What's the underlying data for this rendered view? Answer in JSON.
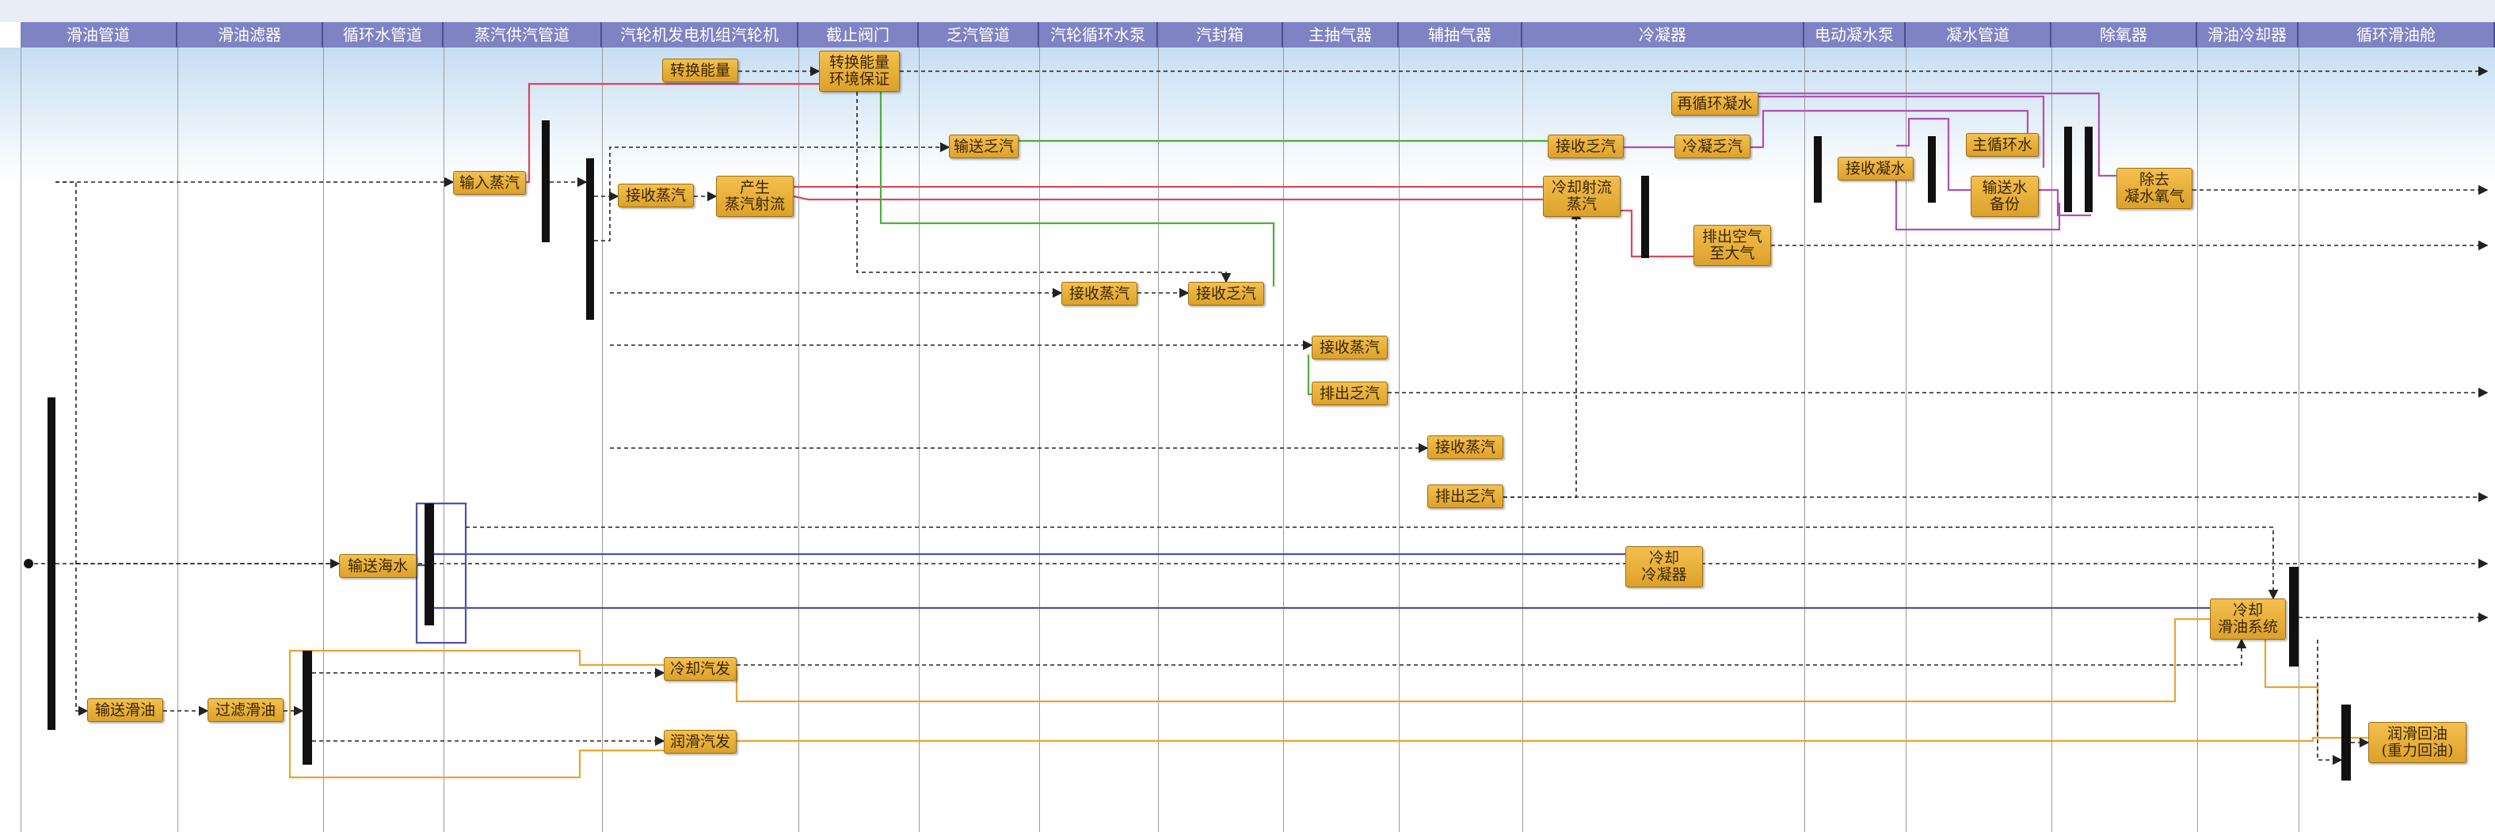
{
  "lanes": [
    {
      "name": "滑油管道"
    },
    {
      "name": "滑油滤器"
    },
    {
      "name": "循环水管道"
    },
    {
      "name": "蒸汽供汽管道"
    },
    {
      "name": "汽轮机发电机组汽轮机"
    },
    {
      "name": "截止阀门"
    },
    {
      "name": "乏汽管道"
    },
    {
      "name": "汽轮循环水泵"
    },
    {
      "name": "汽封箱"
    },
    {
      "name": "主抽气器"
    },
    {
      "name": "辅抽气器"
    },
    {
      "name": "冷凝器"
    },
    {
      "name": "电动凝水泵"
    },
    {
      "name": "凝水管道"
    },
    {
      "name": "除氧器"
    },
    {
      "name": "滑油冷却器"
    },
    {
      "name": "循环滑油舱"
    }
  ],
  "nodes": [
    {
      "id": "input-steam",
      "label": "输入蒸汽"
    },
    {
      "id": "convert-energy",
      "label": "转换能量"
    },
    {
      "id": "convert-energy-env",
      "label": "转换能量\n环境保证"
    },
    {
      "id": "transport-exhaust",
      "label": "输送乏汽"
    },
    {
      "id": "receive-steam-turbine",
      "label": "接收蒸汽"
    },
    {
      "id": "produce-jet",
      "label": "产生\n蒸汽射流"
    },
    {
      "id": "receive-steam-seal",
      "label": "接收蒸汽"
    },
    {
      "id": "receive-exhaust-seal",
      "label": "接收乏汽"
    },
    {
      "id": "receive-steam-main",
      "label": "接收蒸汽"
    },
    {
      "id": "discharge-exhaust-main",
      "label": "排出乏汽"
    },
    {
      "id": "receive-steam-aux",
      "label": "接收蒸汽"
    },
    {
      "id": "discharge-exhaust-aux",
      "label": "排出乏汽"
    },
    {
      "id": "receive-exhaust-cond",
      "label": "接收乏汽"
    },
    {
      "id": "condense-exhaust",
      "label": "冷凝乏汽"
    },
    {
      "id": "cool-jet",
      "label": "冷却射流\n蒸汽"
    },
    {
      "id": "recirculate",
      "label": "再循环凝水"
    },
    {
      "id": "discharge-air",
      "label": "排出空气\n至大气"
    },
    {
      "id": "cool-condenser",
      "label": "冷却\n冷凝器"
    },
    {
      "id": "receive-condensate",
      "label": "接收凝水"
    },
    {
      "id": "main-circ",
      "label": "主循环水"
    },
    {
      "id": "transport-backup",
      "label": "输送水\n备份"
    },
    {
      "id": "deoxygenate",
      "label": "除去\n凝水氧气"
    },
    {
      "id": "transport-seawater",
      "label": "输送海水"
    },
    {
      "id": "transport-oil",
      "label": "输送滑油"
    },
    {
      "id": "filter-oil",
      "label": "过滤滑油"
    },
    {
      "id": "cool-turbine",
      "label": "冷却汽发"
    },
    {
      "id": "lube-turbine",
      "label": "润滑汽发"
    },
    {
      "id": "cool-oil-sys",
      "label": "冷却\n滑油系统"
    },
    {
      "id": "oil-return",
      "label": "润滑回油\n(重力回油)"
    }
  ],
  "colors": {
    "steam_flow": "#d9475a",
    "exhaust_flow": "#4caf3c",
    "condensate_flow": "#b04fb8",
    "seawater_flow": "#4e52a8",
    "oil_flow": "#e8a532",
    "control_flow": "#222222",
    "lane_header": "#7f83c4",
    "node_fill": "#e9b13c"
  }
}
